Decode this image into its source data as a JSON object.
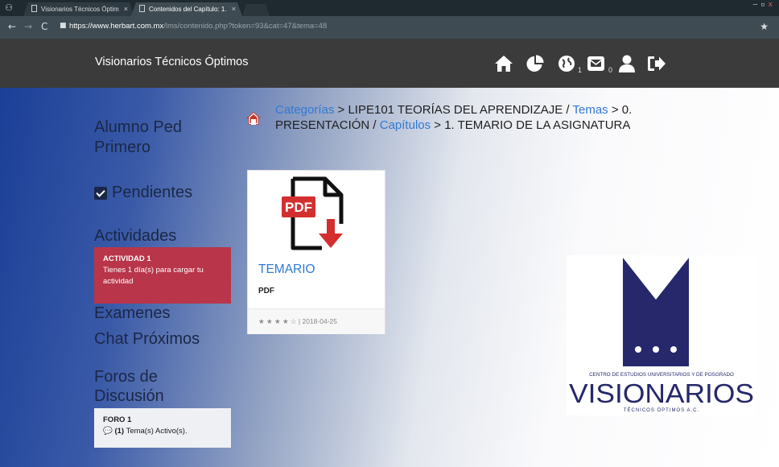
{
  "browser": {
    "tabs": [
      {
        "label": "Visionarios Técnicos Óptim"
      },
      {
        "label": "Contenidos del Capítulo: 1."
      }
    ],
    "url_host": "https://www.herbart.com.mx",
    "url_path": "/lms/contenido.php?token=93&cat=47&tema=48"
  },
  "header": {
    "brand": "Visionarios Técnicos Óptimos",
    "icons": [
      "home-icon",
      "pie-chart-icon",
      "globe-icon",
      "envelope-icon",
      "user-icon",
      "sign-out-icon"
    ],
    "globe_count": "1",
    "messages_count": "0"
  },
  "sidebar": {
    "student_name": "Alumno Ped Primero",
    "pending_label": "Pendientes",
    "activities_heading": "Actividades",
    "activity": {
      "title": "ACTIVIDAD 1",
      "description": "Tienes 1 día(s) para cargar tu actividad"
    },
    "exams_label": "Examenes",
    "chat_label": "Chat Próximos",
    "forums_heading": "Foros de Discusión",
    "forum": {
      "title": "FORO 1",
      "count": "(1)",
      "description": "Tema(s) Activo(s)."
    },
    "colors": {
      "activity_card": "#b8354a",
      "forum_card": "#eef0f4"
    }
  },
  "breadcrumb": {
    "categories_link": "Categorías",
    "course": " > LIPE101 TEORÍAS DEL APRENDIZAJE / ",
    "topics_link": "Temas",
    "topic": " > 0. PRESENTACIÓN / ",
    "chapters_link": "Capítulos",
    "chapter": " > 1. TEMARIO DE LA ASIGNATURA"
  },
  "content_card": {
    "icon_label": "PDF",
    "title": "TEMARIO",
    "type": "PDF",
    "rating_stars": "★ ★ ★ ★ ☆",
    "rating": 4,
    "rating_max": 5,
    "date": "2018-04-25"
  },
  "logo": {
    "caption_top": "CENTRO DE ESTUDIOS UNIVERSITARIOS Y DE POSGRADO",
    "wordmark": "VISIONARIOS",
    "caption_bottom": "TÉCNICOS ÓPTIMOS A.C.",
    "color": "#26286b"
  }
}
